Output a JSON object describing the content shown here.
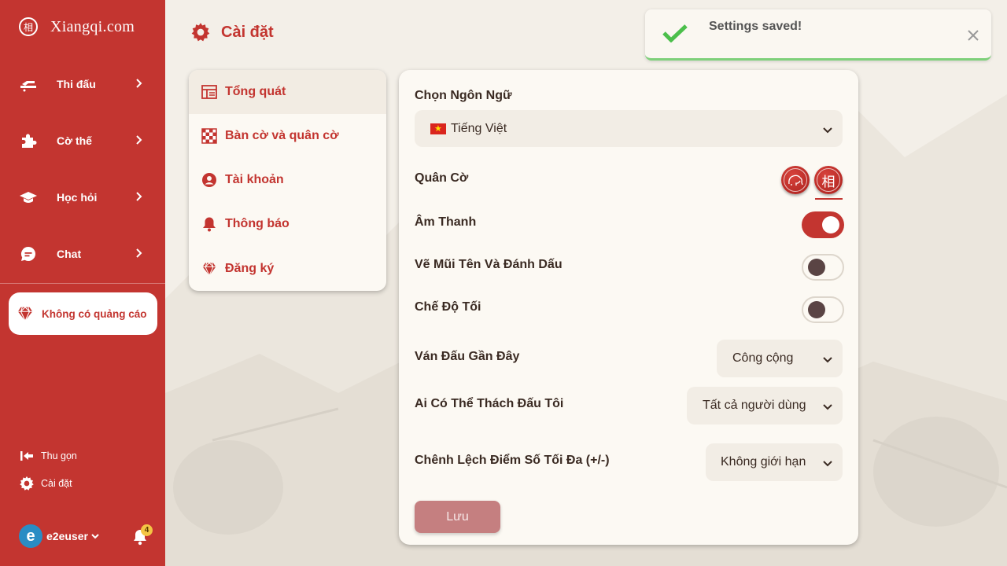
{
  "brand": {
    "name": "Xiangqi.com",
    "mark": "相"
  },
  "sidebar": {
    "items": [
      {
        "label": "Thi đấu",
        "icon": "tournament-icon"
      },
      {
        "label": "Cờ thế",
        "icon": "puzzle-icon"
      },
      {
        "label": "Học hỏi",
        "icon": "graduation-cap-icon"
      },
      {
        "label": "Chat",
        "icon": "chat-icon"
      }
    ],
    "no_ads": "Không có quảng cáo",
    "collapse": "Thu gọn",
    "settings": "Cài đặt",
    "user": {
      "initial": "e",
      "name": "e2euser"
    },
    "notification_count": "4"
  },
  "page": {
    "title": "Cài đặt"
  },
  "settings_menu": {
    "items": [
      {
        "label": "Tổng quát",
        "icon": "layout-icon",
        "active": true
      },
      {
        "label": "Bàn cờ và quân cờ",
        "icon": "checkerboard-icon"
      },
      {
        "label": "Tài khoản",
        "icon": "user-circle-icon"
      },
      {
        "label": "Thông báo",
        "icon": "bell-icon"
      },
      {
        "label": "Đăng ký",
        "icon": "diamond-icon"
      }
    ]
  },
  "general": {
    "language_label": "Chọn Ngôn Ngữ",
    "language_value": "Tiếng Việt",
    "pieces_label": "Quân Cờ",
    "piece_glyph": "相",
    "sound_label": "Âm Thanh",
    "sound_on": true,
    "arrows_label": "Vẽ Mũi Tên Và Đánh Dấu",
    "arrows_on": false,
    "dark_label": "Chế Độ Tối",
    "dark_on": false,
    "recent_games_label": "Ván Đấu Gần Đây",
    "recent_games_value": "Công cộng",
    "challenge_label": "Ai Có Thể Thách Đấu Tôi",
    "challenge_value": "Tất cả người dùng",
    "max_rating_label": "Chênh Lệch Điểm Số Tối Đa (+/-)",
    "max_rating_value": "Không giới hạn",
    "save_label": "Lưu"
  },
  "toast": {
    "message": "Settings saved!"
  },
  "colors": {
    "brand_red": "#c33530",
    "success_green": "#4bbf4b",
    "background": "#f3efe8"
  }
}
